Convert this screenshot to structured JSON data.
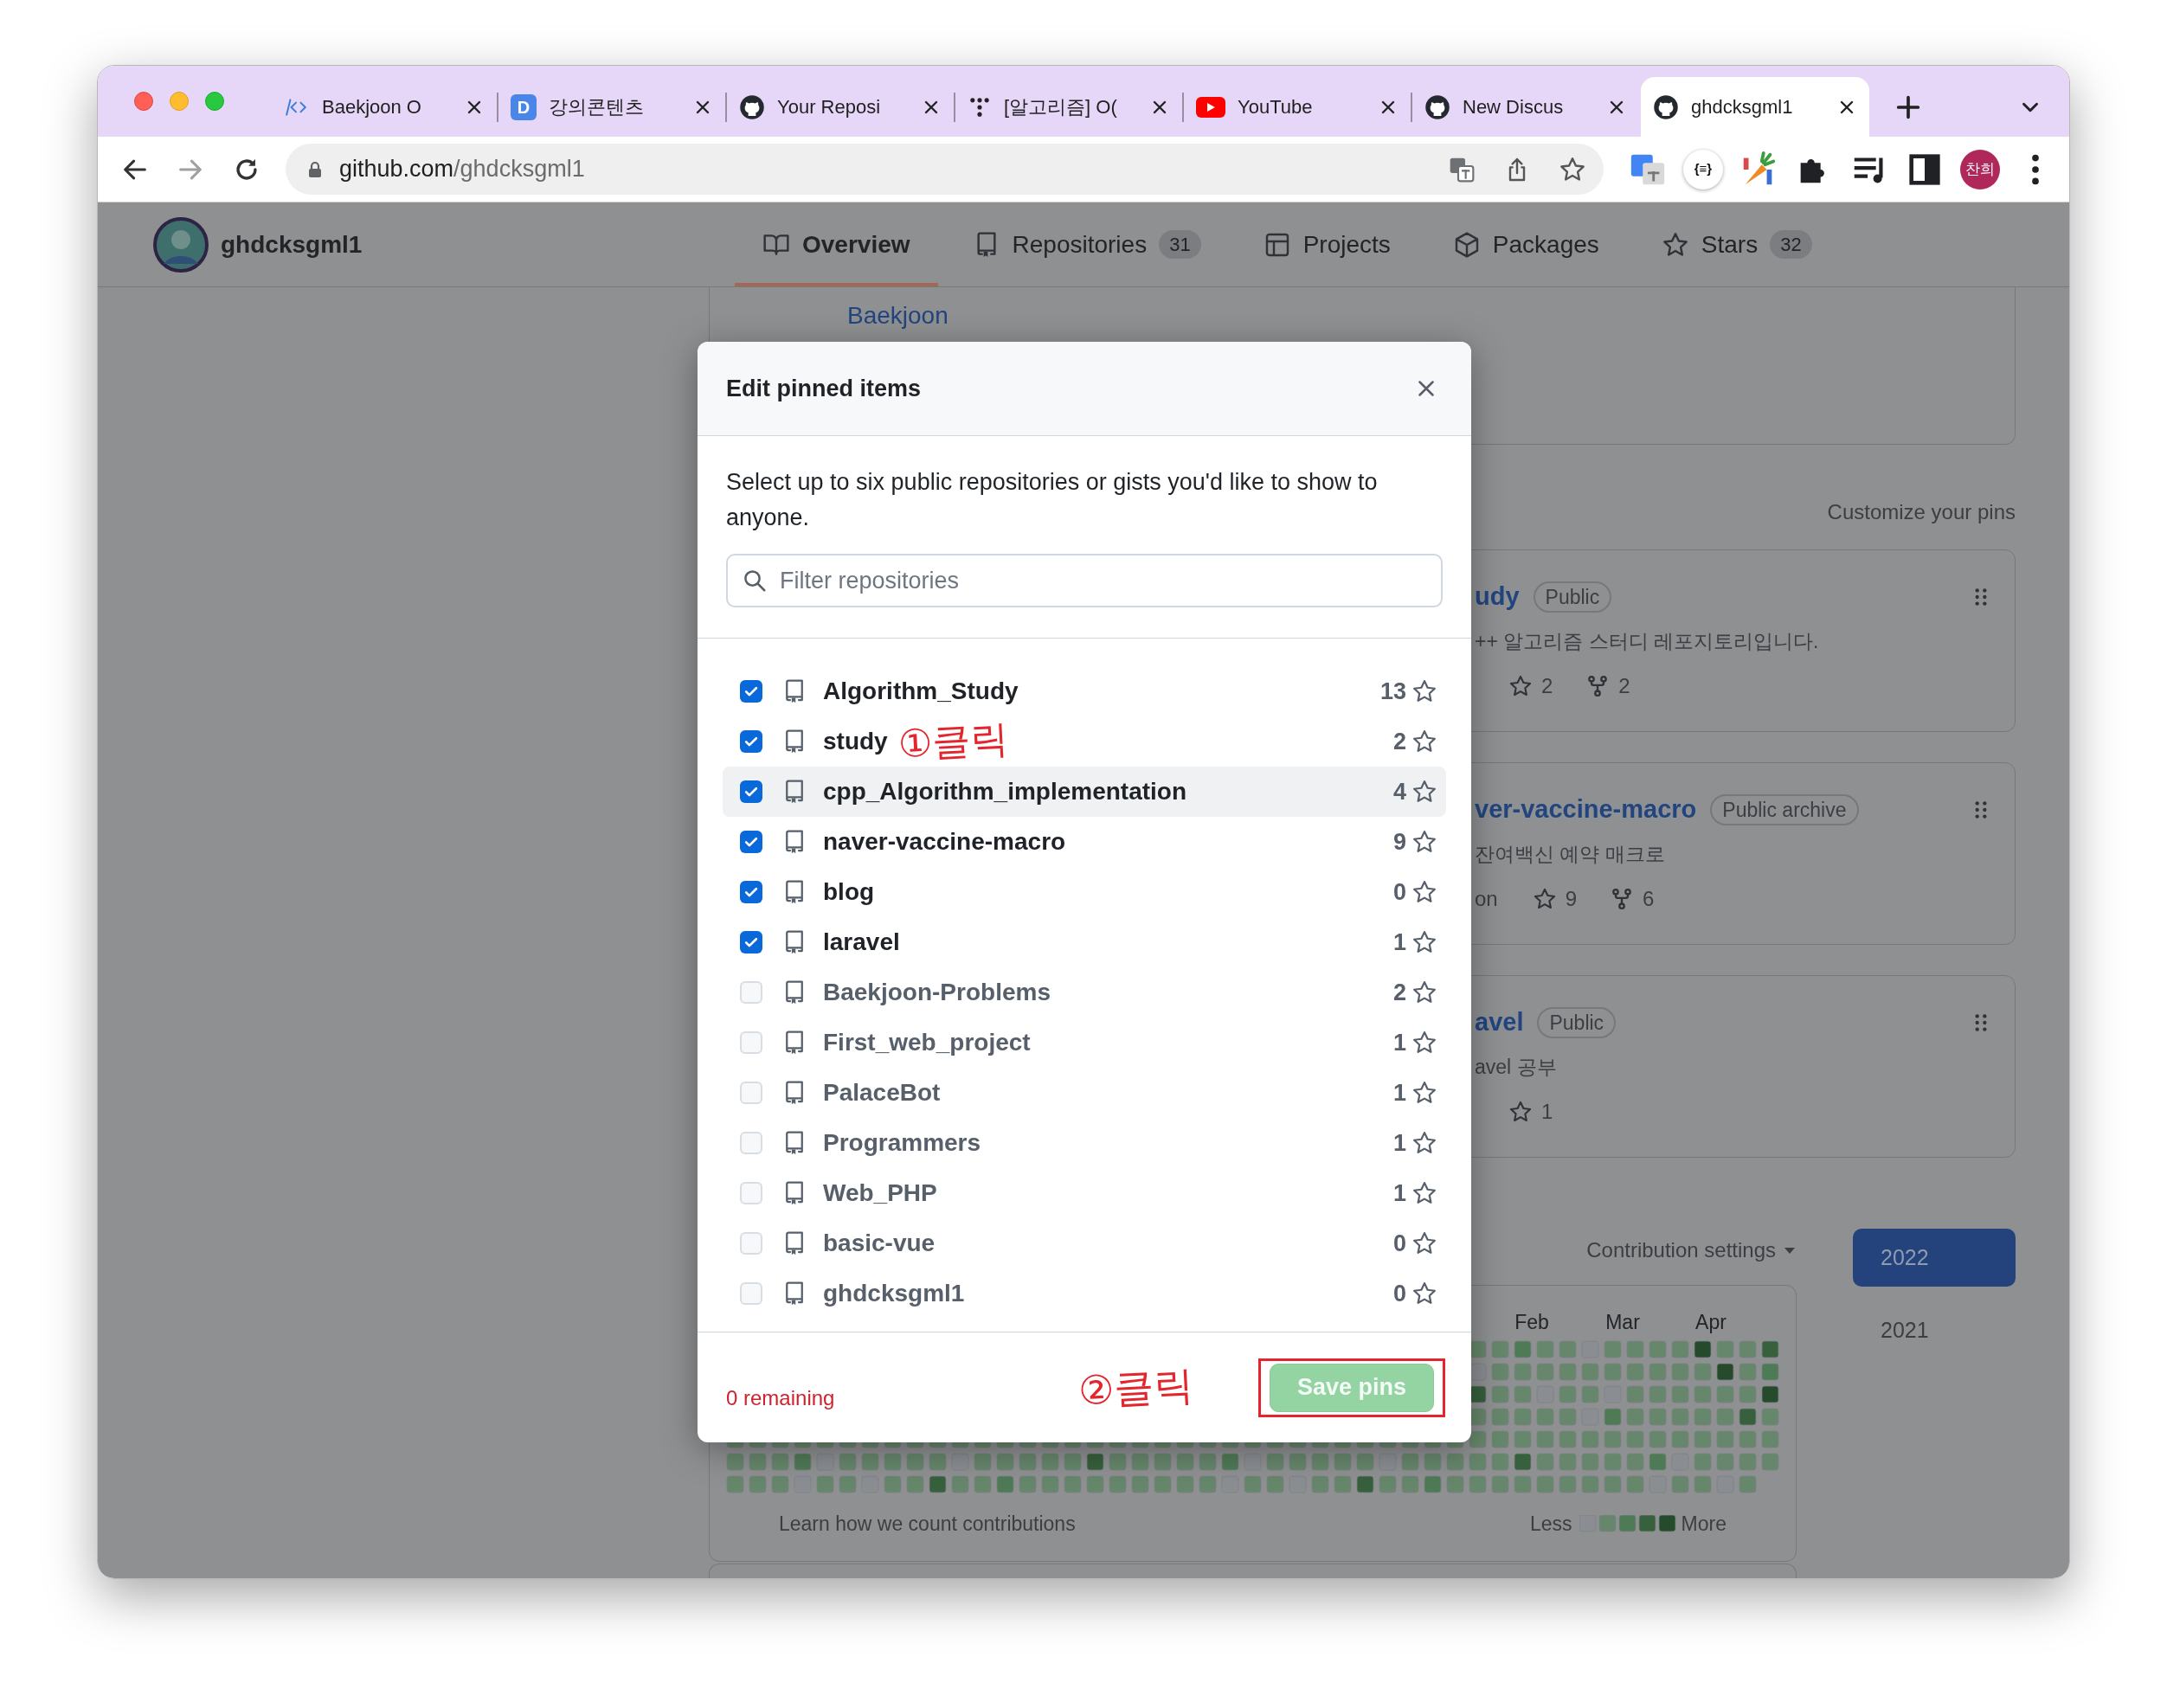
{
  "browser": {
    "tabs": [
      {
        "title": "Baekjoon O",
        "kind": "code",
        "selected": false
      },
      {
        "title": "강의콘텐츠",
        "kind": "letter-tile",
        "icon_text": "D",
        "selected": false
      },
      {
        "title": "Your Reposi",
        "kind": "cat-logo",
        "selected": false
      },
      {
        "title": "[알고리즘] O(",
        "kind": "dots",
        "selected": false
      },
      {
        "title": "YouTube",
        "kind": "video-play",
        "selected": false
      },
      {
        "title": "New Discus",
        "kind": "cat-logo",
        "selected": false
      },
      {
        "title": "ghdcksgml1",
        "kind": "cat-logo",
        "selected": true
      }
    ],
    "url_host": "github.com",
    "url_path": "/ghdcksgml1",
    "extensions": [
      {
        "kind": "translate"
      },
      {
        "kind": "text-badge",
        "text": "{≡}"
      },
      {
        "kind": "carrot"
      },
      {
        "kind": "puzzle"
      },
      {
        "kind": "playlist"
      },
      {
        "kind": "sidebar"
      },
      {
        "kind": "profile",
        "text": "찬희"
      },
      {
        "kind": "menu"
      }
    ]
  },
  "profile": {
    "username": "ghdcksgml1",
    "nav": [
      {
        "label": "Overview",
        "kind": "book",
        "selected": true
      },
      {
        "label": "Repositories",
        "kind": "repo",
        "count": "31",
        "selected": false
      },
      {
        "label": "Projects",
        "kind": "table",
        "selected": false
      },
      {
        "label": "Packages",
        "kind": "package",
        "selected": false
      },
      {
        "label": "Stars",
        "kind": "star",
        "count": "32",
        "selected": false
      }
    ]
  },
  "readme": {
    "link": "Baekjoon"
  },
  "pinned": {
    "customize_label": "Customize your pins",
    "cards": [
      {
        "title": "udy",
        "visibility": "Public",
        "description": "++ 알고리즘 스터디 레포지토리입니다.",
        "star_count": "2",
        "fork_count": "2"
      },
      {
        "title": "ver-vaccine-macro",
        "visibility": "Public archive",
        "description": "잔여백신 예약 매크로",
        "language": "on",
        "star_count": "9",
        "fork_count": "6"
      },
      {
        "title": "avel",
        "visibility": "Public",
        "description": "avel 공부",
        "star_count": "1"
      }
    ]
  },
  "contributions": {
    "settings_label": "Contribution settings",
    "months": [
      "Feb",
      "Mar",
      "Apr"
    ],
    "learn_label": "Learn how we count contributions",
    "legend_less": "Less",
    "legend_more": "More",
    "years": [
      {
        "label": "2022",
        "selected": true
      },
      {
        "label": "2021",
        "selected": false
      }
    ]
  },
  "dialog": {
    "title": "Edit pinned items",
    "description": "Select up to six public repositories or gists you'd like to show to anyone.",
    "filter_placeholder": "Filter repositories",
    "repositories": [
      {
        "name": "Algorithm_Study",
        "star_count": "13",
        "checked": true,
        "highlighted": false
      },
      {
        "name": "study",
        "star_count": "2",
        "checked": true,
        "highlighted": false,
        "annotation": "①클릭"
      },
      {
        "name": "cpp_Algorithm_implementation",
        "star_count": "4",
        "checked": true,
        "highlighted": true
      },
      {
        "name": "naver-vaccine-macro",
        "star_count": "9",
        "checked": true,
        "highlighted": false
      },
      {
        "name": "blog",
        "star_count": "0",
        "checked": true,
        "highlighted": false
      },
      {
        "name": "laravel",
        "star_count": "1",
        "checked": true,
        "highlighted": false
      },
      {
        "name": "Baekjoon-Problems",
        "star_count": "2",
        "checked": false,
        "highlighted": false
      },
      {
        "name": "First_web_project",
        "star_count": "1",
        "checked": false,
        "highlighted": false
      },
      {
        "name": "PalaceBot",
        "star_count": "1",
        "checked": false,
        "highlighted": false
      },
      {
        "name": "Programmers",
        "star_count": "1",
        "checked": false,
        "highlighted": false
      },
      {
        "name": "Web_PHP",
        "star_count": "1",
        "checked": false,
        "highlighted": false
      },
      {
        "name": "basic-vue",
        "star_count": "0",
        "checked": false,
        "highlighted": false
      },
      {
        "name": "ghdcksgml1",
        "star_count": "0",
        "checked": false,
        "highlighted": false
      }
    ],
    "remaining": "0 remaining",
    "save_annotation": "②클릭",
    "save_button": {
      "label": "Save pins",
      "disabled": true
    }
  }
}
